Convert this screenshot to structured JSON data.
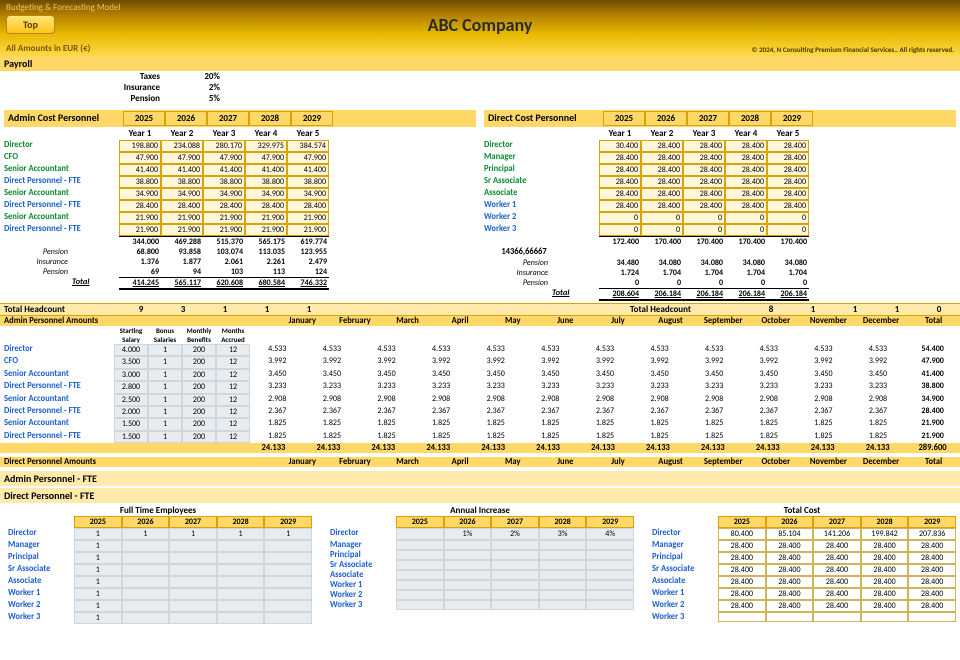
{
  "header": {
    "model_label": "Budgeting & Forecasting  Model",
    "top_button": "Top",
    "company": "ABC Company",
    "amounts_label": "All Amounts in  EUR (€)",
    "copyright": "© 2024, N Consulting Premium Financial Services.. All rights reserved."
  },
  "payroll": {
    "title": "Payroll",
    "rows": [
      {
        "label": "Taxes",
        "value": "20%"
      },
      {
        "label": "Insurance",
        "value": "2%"
      },
      {
        "label": "Pension",
        "value": "5%"
      }
    ]
  },
  "years": [
    "2025",
    "2026",
    "2027",
    "2028",
    "2029"
  ],
  "year_labels": [
    "Year 1",
    "Year 2",
    "Year 3",
    "Year 4",
    "Year 5"
  ],
  "admin_title": "Admin Cost Personnel",
  "direct_title": "Direct Cost Personnel",
  "admin_roles": [
    {
      "name": "Director",
      "cls": "",
      "v": [
        "198.800",
        "234.088",
        "280.170",
        "329.975",
        "384.574"
      ]
    },
    {
      "name": "CFO",
      "cls": "",
      "v": [
        "47.900",
        "47.900",
        "47.900",
        "47.900",
        "47.900"
      ]
    },
    {
      "name": "Senior Accountant",
      "cls": "",
      "v": [
        "41.400",
        "41.400",
        "41.400",
        "41.400",
        "41.400"
      ]
    },
    {
      "name": "Direct Personnel - FTE",
      "cls": "blue",
      "v": [
        "38.800",
        "38.800",
        "38.800",
        "38.800",
        "38.800"
      ]
    },
    {
      "name": "Senior Accountant",
      "cls": "",
      "v": [
        "34.900",
        "34.900",
        "34.900",
        "34.900",
        "34.900"
      ]
    },
    {
      "name": "Direct Personnel - FTE",
      "cls": "blue",
      "v": [
        "28.400",
        "28.400",
        "28.400",
        "28.400",
        "28.400"
      ]
    },
    {
      "name": "Senior Accountant",
      "cls": "",
      "v": [
        "21.900",
        "21.900",
        "21.900",
        "21.900",
        "21.900"
      ]
    },
    {
      "name": "Direct Personnel - FTE",
      "cls": "blue",
      "v": [
        "21.900",
        "21.900",
        "21.900",
        "21.900",
        "21.900"
      ]
    }
  ],
  "admin_subtotal": [
    "344.000",
    "469.288",
    "515.370",
    "565.175",
    "619.774"
  ],
  "admin_extras": [
    {
      "label": "Pension",
      "v": [
        "68.800",
        "93.858",
        "103.074",
        "113.035",
        "123.955"
      ]
    },
    {
      "label": "Insurance",
      "v": [
        "1.376",
        "1.877",
        "2.061",
        "2.261",
        "2.479"
      ]
    },
    {
      "label": "Pension",
      "v": [
        "69",
        "94",
        "103",
        "113",
        "124"
      ]
    }
  ],
  "admin_total_label": "Total",
  "admin_total": [
    "414.245",
    "565.117",
    "620.608",
    "680.584",
    "746.332"
  ],
  "direct_roles": [
    {
      "name": "Director",
      "cls": "",
      "v": [
        "30.400",
        "28.400",
        "28.400",
        "28.400",
        "28.400"
      ]
    },
    {
      "name": "Manager",
      "cls": "",
      "v": [
        "28.400",
        "28.400",
        "28.400",
        "28.400",
        "28.400"
      ]
    },
    {
      "name": "Principal",
      "cls": "",
      "v": [
        "28.400",
        "28.400",
        "28.400",
        "28.400",
        "28.400"
      ]
    },
    {
      "name": "Sr Associate",
      "cls": "",
      "v": [
        "28.400",
        "28.400",
        "28.400",
        "28.400",
        "28.400"
      ]
    },
    {
      "name": "Associate",
      "cls": "",
      "v": [
        "28.400",
        "28.400",
        "28.400",
        "28.400",
        "28.400"
      ]
    },
    {
      "name": "Worker 1",
      "cls": "blue",
      "v": [
        "28.400",
        "28.400",
        "28.400",
        "28.400",
        "28.400"
      ]
    },
    {
      "name": "Worker 2",
      "cls": "blue",
      "v": [
        "0",
        "0",
        "0",
        "0",
        "0"
      ]
    },
    {
      "name": "Worker 3",
      "cls": "blue",
      "v": [
        "0",
        "0",
        "0",
        "0",
        "0"
      ]
    }
  ],
  "direct_subtotal": [
    "172.400",
    "170.400",
    "170.400",
    "170.400",
    "170.400"
  ],
  "direct_misc": "14366,66667",
  "direct_extras": [
    {
      "label": "Pension",
      "v": [
        "34.480",
        "34.080",
        "34.080",
        "34.080",
        "34.080"
      ]
    },
    {
      "label": "Insurance",
      "v": [
        "1.724",
        "1.704",
        "1.704",
        "1.704",
        "1.704"
      ]
    },
    {
      "label": "Pension",
      "v": [
        "0",
        "0",
        "0",
        "0",
        "0"
      ]
    }
  ],
  "direct_total": [
    "208.604",
    "206.184",
    "206.184",
    "206.184",
    "206.184"
  ],
  "hc_label": "Total Headcount",
  "hc_admin": [
    "9",
    "3",
    "1",
    "1",
    "1"
  ],
  "hc_direct": [
    "8",
    "1",
    "1",
    "1",
    "0"
  ],
  "apa_title": "Admin Personnel Amounts",
  "apa_heads": [
    "Starting Salary",
    "Bonus Salaries",
    "Monthly Benefits",
    "Months Accrued"
  ],
  "months": [
    "January",
    "February",
    "March",
    "April",
    "May",
    "June",
    "July",
    "August",
    "September",
    "October",
    "November",
    "December",
    "Total"
  ],
  "apa_rows": [
    {
      "name": "Director",
      "s": "4.000",
      "b": "1",
      "mb": "200",
      "ma": "12",
      "mv": "4.533",
      "tot": "54.400"
    },
    {
      "name": "CFO",
      "s": "3.500",
      "b": "1",
      "mb": "200",
      "ma": "12",
      "mv": "3.992",
      "tot": "47.900"
    },
    {
      "name": "Senior Accountant",
      "s": "3.000",
      "b": "1",
      "mb": "200",
      "ma": "12",
      "mv": "3.450",
      "tot": "41.400"
    },
    {
      "name": "Direct Personnel - FTE",
      "s": "2.800",
      "b": "1",
      "mb": "200",
      "ma": "12",
      "mv": "3.233",
      "tot": "38.800"
    },
    {
      "name": "Senior Accountant",
      "s": "2.500",
      "b": "1",
      "mb": "200",
      "ma": "12",
      "mv": "2.908",
      "tot": "34.900"
    },
    {
      "name": "Direct Personnel - FTE",
      "s": "2.000",
      "b": "1",
      "mb": "200",
      "ma": "12",
      "mv": "2.367",
      "tot": "28.400"
    },
    {
      "name": "Senior Accountant",
      "s": "1.500",
      "b": "1",
      "mb": "200",
      "ma": "12",
      "mv": "1.825",
      "tot": "21.900"
    },
    {
      "name": "Direct Personnel - FTE",
      "s": "1.500",
      "b": "1",
      "mb": "200",
      "ma": "12",
      "mv": "1.825",
      "tot": "21.900"
    }
  ],
  "apa_sum": "24.133",
  "apa_sum_total": "289.600",
  "dpa_title": "Direct Personnel Amounts",
  "apf_title": "Admin Personnel - FTE",
  "dpf_title": "Direct Personnel - FTE",
  "bottom": {
    "titles": [
      "Full Time Employees",
      "Annual Increase",
      "Total Cost"
    ],
    "rows": [
      {
        "name": "Director",
        "fte": [
          "1",
          "1",
          "1",
          "1",
          "1"
        ],
        "inc": [
          "",
          "1%",
          "2%",
          "3%",
          "4%"
        ],
        "tc": [
          "80.400",
          "85.104",
          "141.206",
          "199.842",
          "207.836"
        ]
      },
      {
        "name": "Manager",
        "fte": [
          "1",
          "",
          "",
          "",
          ""
        ],
        "inc": [
          "",
          "",
          "",
          "",
          ""
        ],
        "tc": [
          "28.400",
          "28.400",
          "28.400",
          "28.400",
          "28.400"
        ]
      },
      {
        "name": "Principal",
        "fte": [
          "1",
          "",
          "",
          "",
          ""
        ],
        "inc": [
          "",
          "",
          "",
          "",
          ""
        ],
        "tc": [
          "28.400",
          "28.400",
          "28.400",
          "28.400",
          "28.400"
        ]
      },
      {
        "name": "Sr Associate",
        "fte": [
          "1",
          "",
          "",
          "",
          ""
        ],
        "inc": [
          "",
          "",
          "",
          "",
          ""
        ],
        "tc": [
          "28.400",
          "28.400",
          "28.400",
          "28.400",
          "28.400"
        ]
      },
      {
        "name": "Associate",
        "fte": [
          "1",
          "",
          "",
          "",
          ""
        ],
        "inc": [
          "",
          "",
          "",
          "",
          ""
        ],
        "tc": [
          "28.400",
          "28.400",
          "28.400",
          "28.400",
          "28.400"
        ]
      },
      {
        "name": "Worker 1",
        "fte": [
          "1",
          "",
          "",
          "",
          ""
        ],
        "inc": [
          "",
          "",
          "",
          "",
          ""
        ],
        "tc": [
          "28.400",
          "28.400",
          "28.400",
          "28.400",
          "28.400"
        ]
      },
      {
        "name": "Worker 2",
        "fte": [
          "1",
          "",
          "",
          "",
          ""
        ],
        "inc": [
          "",
          "",
          "",
          "",
          ""
        ],
        "tc": [
          "28.400",
          "28.400",
          "28.400",
          "28.400",
          "28.400"
        ]
      },
      {
        "name": "Worker 3",
        "fte": [
          "1",
          "",
          "",
          "",
          ""
        ],
        "inc": [
          "",
          "",
          "",
          "",
          ""
        ],
        "tc": [
          "",
          "",
          "",
          "",
          ""
        ]
      }
    ]
  }
}
